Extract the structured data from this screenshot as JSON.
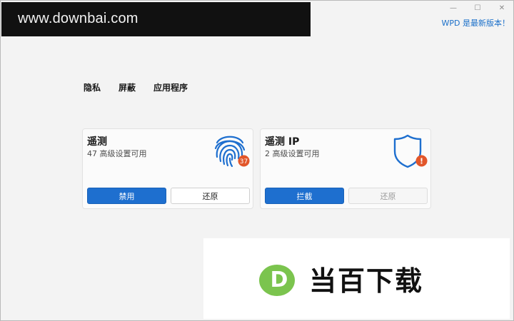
{
  "watermark_top": "www.downbai.com",
  "window_controls": {
    "minimize": "—",
    "maximize": "☐",
    "close": "✕"
  },
  "update_notice": "WPD 是最新版本！",
  "tabs": [
    {
      "label": "隐私"
    },
    {
      "label": "屏蔽"
    },
    {
      "label": "应用程序"
    }
  ],
  "cards": [
    {
      "title": "遥测",
      "subtitle": "47 高级设置可用",
      "badge": "37",
      "icon": "fingerprint-icon",
      "primary_label": "禁用",
      "secondary_label": "还原"
    },
    {
      "title": "遥测 IP",
      "subtitle": "2 高级设置可用",
      "badge": "!",
      "icon": "shield-icon",
      "primary_label": "拦截",
      "secondary_label": "还原"
    }
  ],
  "watermark_logo": {
    "letter": "D",
    "text": "当百下载"
  },
  "colors": {
    "accent": "#1e6fcf",
    "badge": "#e2562a",
    "link": "#1a6fc9",
    "logo_green": "#7bc44e"
  }
}
